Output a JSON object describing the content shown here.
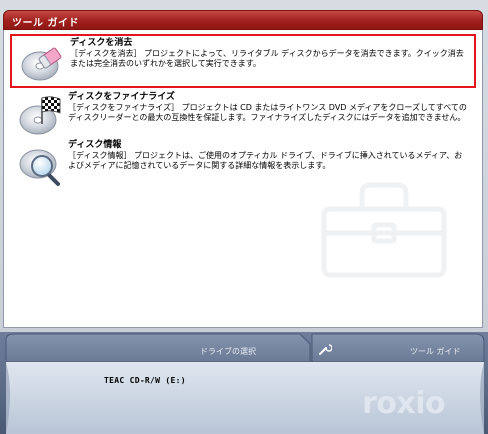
{
  "header": {
    "title": "ツール ガイド"
  },
  "items": [
    {
      "title": "ディスクを消去",
      "description": "［ディスクを消去］ プロジェクトによって、リライタブル ディスクからデータを消去できます。クイック消去または完全消去のいずれかを選択して実行できます。",
      "icon": "eraser-disc-icon",
      "selected": true
    },
    {
      "title": "ディスクをファイナライズ",
      "description": "［ディスクをファイナライズ］ プロジェクトは CD またはライトワンス DVD メディアをクローズしてすべてのディスクリーダーとの最大の互換性を保証します。ファイナライズしたディスクにはデータを追加できません。",
      "icon": "checkered-flag-disc-icon",
      "selected": false
    },
    {
      "title": "ディスク情報",
      "description": "［ディスク情報］ プロジェクトは、ご使用のオプティカル ドライブ、ドライブに挿入されているメディア、およびメディアに記憶されているデータに関する詳細な情報を表示します。",
      "icon": "magnifier-disc-icon",
      "selected": false
    }
  ],
  "bottom": {
    "drive_tab_label": "ドライブの選択",
    "tool_tab_label": "ツール ガイド",
    "drive_name": "TEAC CD-R/W (E:)",
    "brand": "roxio"
  },
  "colors": {
    "header_red": "#a1201d",
    "selection_red": "#e3171b",
    "bottom_blue": "#5a6b86"
  }
}
